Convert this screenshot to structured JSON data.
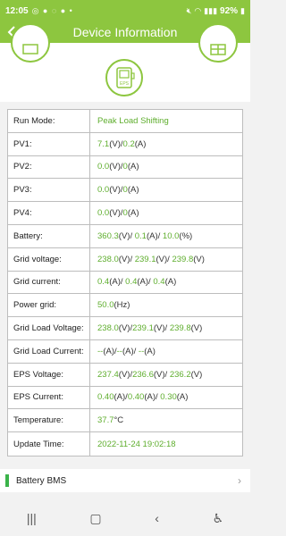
{
  "status": {
    "time": "12:05",
    "battery": "92%"
  },
  "header": {
    "title": "Device Information"
  },
  "center_icon_label": "EPS",
  "rows": [
    {
      "label": "Run Mode:",
      "parts": [
        [
          "g",
          "Peak Load Shifting"
        ]
      ]
    },
    {
      "label": "PV1:",
      "parts": [
        [
          "g",
          "7.1"
        ],
        [
          "k",
          "(V)/"
        ],
        [
          "g",
          "0.2"
        ],
        [
          "k",
          "(A)"
        ]
      ]
    },
    {
      "label": "PV2:",
      "parts": [
        [
          "g",
          "0.0"
        ],
        [
          "k",
          "(V)/"
        ],
        [
          "g",
          "0"
        ],
        [
          "k",
          "(A)"
        ]
      ]
    },
    {
      "label": "PV3:",
      "parts": [
        [
          "g",
          "0.0"
        ],
        [
          "k",
          "(V)/"
        ],
        [
          "g",
          "0"
        ],
        [
          "k",
          "(A)"
        ]
      ]
    },
    {
      "label": "PV4:",
      "parts": [
        [
          "g",
          "0.0"
        ],
        [
          "k",
          "(V)/"
        ],
        [
          "g",
          "0"
        ],
        [
          "k",
          "(A)"
        ]
      ]
    },
    {
      "label": "Battery:",
      "parts": [
        [
          "g",
          "360.3"
        ],
        [
          "k",
          "(V)/ "
        ],
        [
          "g",
          "0.1"
        ],
        [
          "k",
          "(A)/ "
        ],
        [
          "g",
          "10.0"
        ],
        [
          "k",
          "(%)"
        ]
      ]
    },
    {
      "label": "Grid voltage:",
      "parts": [
        [
          "g",
          "238.0"
        ],
        [
          "k",
          "(V)/ "
        ],
        [
          "g",
          "239.1"
        ],
        [
          "k",
          "(V)/ "
        ],
        [
          "g",
          "239.8"
        ],
        [
          "k",
          "(V)"
        ]
      ]
    },
    {
      "label": "Grid current:",
      "parts": [
        [
          "g",
          "0.4"
        ],
        [
          "k",
          "(A)/ "
        ],
        [
          "g",
          "0.4"
        ],
        [
          "k",
          "(A)/ "
        ],
        [
          "g",
          "0.4"
        ],
        [
          "k",
          "(A)"
        ]
      ]
    },
    {
      "label": "Power grid:",
      "parts": [
        [
          "g",
          "50.0"
        ],
        [
          "k",
          "(Hz)"
        ]
      ]
    },
    {
      "label": "Grid Load Voltage:",
      "parts": [
        [
          "g",
          "238.0"
        ],
        [
          "k",
          "(V)/"
        ],
        [
          "g",
          "239.1"
        ],
        [
          "k",
          "(V)/ "
        ],
        [
          "g",
          "239.8"
        ],
        [
          "k",
          "(V)"
        ]
      ]
    },
    {
      "label": "Grid Load Current:",
      "parts": [
        [
          "g",
          "--"
        ],
        [
          "k",
          "(A)/"
        ],
        [
          "g",
          "--"
        ],
        [
          "k",
          "(A)/ "
        ],
        [
          "g",
          "--"
        ],
        [
          "k",
          "(A)"
        ]
      ]
    },
    {
      "label": "EPS Voltage:",
      "parts": [
        [
          "g",
          "237.4"
        ],
        [
          "k",
          "(V)/"
        ],
        [
          "g",
          "236.6"
        ],
        [
          "k",
          "(V)/ "
        ],
        [
          "g",
          "236.2"
        ],
        [
          "k",
          "(V)"
        ]
      ]
    },
    {
      "label": "EPS Current:",
      "parts": [
        [
          "g",
          "0.40"
        ],
        [
          "k",
          "(A)/"
        ],
        [
          "g",
          "0.40"
        ],
        [
          "k",
          "(A)/ "
        ],
        [
          "g",
          "0.30"
        ],
        [
          "k",
          "(A)"
        ]
      ]
    },
    {
      "label": "Temperature:",
      "parts": [
        [
          "g",
          "37.7"
        ],
        [
          "k",
          "°C"
        ]
      ]
    },
    {
      "label": "Update Time:",
      "parts": [
        [
          "g",
          "2022-11-24 19:02:18"
        ]
      ]
    }
  ],
  "bms": {
    "label": "Battery BMS"
  },
  "colors": {
    "accent": "#8dc63f",
    "value_green": "#5fae2e"
  }
}
